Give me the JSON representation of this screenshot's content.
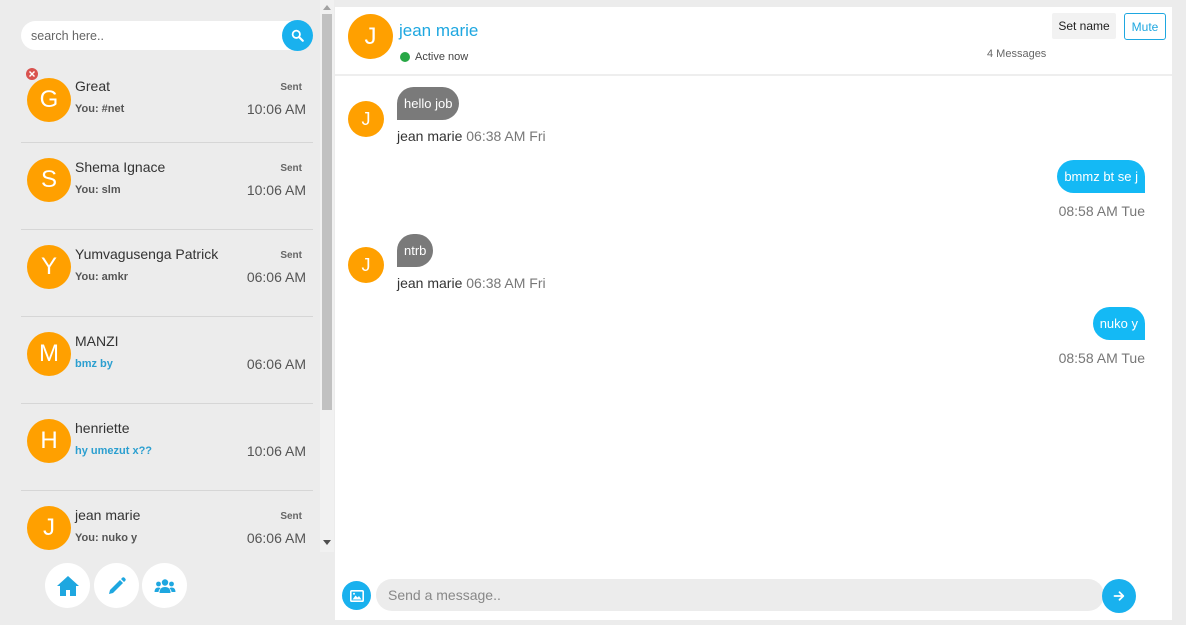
{
  "search": {
    "placeholder": "search here.."
  },
  "conversations": [
    {
      "initial": "G",
      "name": "Great",
      "status": "Sent",
      "preview": "You: #net",
      "time": "10:06 AM"
    },
    {
      "initial": "S",
      "name": "Shema Ignace",
      "status": "Sent",
      "preview": "You: slm",
      "time": "10:06 AM"
    },
    {
      "initial": "Y",
      "name": "Yumvagusenga Patrick",
      "status": "Sent",
      "preview": "You: amkr",
      "time": "06:06 AM"
    },
    {
      "initial": "M",
      "name": "MANZI",
      "status": "",
      "preview": "bmz by",
      "time": "06:06 AM"
    },
    {
      "initial": "H",
      "name": "henriette",
      "status": "",
      "preview": "hy umezut x??",
      "time": "10:06 AM"
    },
    {
      "initial": "J",
      "name": "jean marie",
      "status": "Sent",
      "preview": "You: nuko y",
      "time": "06:06 AM"
    }
  ],
  "nav": {
    "icons": [
      "home-icon",
      "pencil-icon",
      "users-icon"
    ]
  },
  "chat": {
    "initial": "J",
    "title": "jean marie",
    "presence": "Active now",
    "message_count": "4 Messages",
    "set_name_label": "Set name",
    "mute_label": "Mute",
    "messages": [
      {
        "direction": "in",
        "initial": "J",
        "text": "hello job",
        "sender": "jean marie",
        "time": "06:38 AM Fri"
      },
      {
        "direction": "out",
        "text": "bmmz bt se j",
        "time": "08:58 AM Tue"
      },
      {
        "direction": "in",
        "initial": "J",
        "text": "ntrb",
        "sender": "jean marie",
        "time": "06:38 AM Fri"
      },
      {
        "direction": "out",
        "text": "nuko y",
        "time": "08:58 AM Tue"
      }
    ],
    "composer_placeholder": "Send a message.."
  },
  "colors": {
    "accent": "#19b1ee",
    "avatar": "#ffa000",
    "incoming_bubble": "#7a7a7a",
    "online": "#27a745"
  }
}
